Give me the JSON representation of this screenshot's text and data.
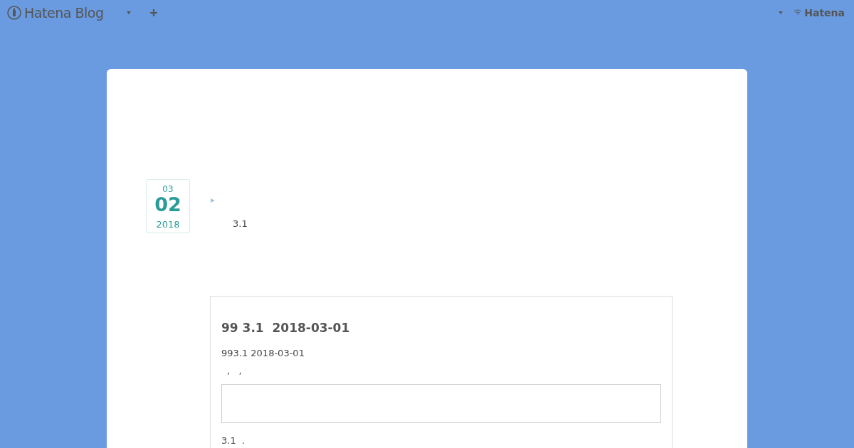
{
  "header": {
    "logo": "Hatena Blog",
    "brand": "Hatena"
  },
  "entry": {
    "date": {
      "month": "03",
      "day": "02",
      "year": "2018"
    },
    "category_text": "3.1",
    "article": {
      "title": "99 3.1  2018-03-01",
      "subtitle": "993.1 2018-03-01",
      "marks": ",   ,",
      "body": "3.1  ."
    }
  }
}
